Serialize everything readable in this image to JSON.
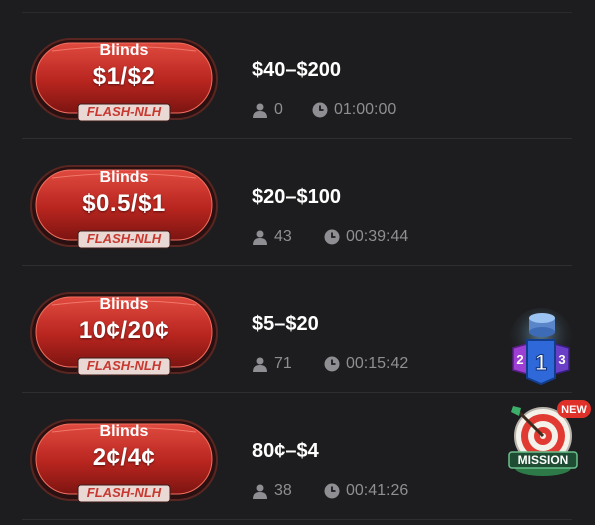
{
  "tables": [
    {
      "blinds_label": "Blinds",
      "blinds": "$1/$2",
      "game_type": "FLASH-NLH",
      "buy_in": "$40–$200",
      "players": "0",
      "time": "01:00:00"
    },
    {
      "blinds_label": "Blinds",
      "blinds": "$0.5/$1",
      "game_type": "FLASH-NLH",
      "buy_in": "$20–$100",
      "players": "43",
      "time": "00:39:44"
    },
    {
      "blinds_label": "Blinds",
      "blinds": "10¢/20¢",
      "game_type": "FLASH-NLH",
      "buy_in": "$5–$20",
      "players": "71",
      "time": "00:15:42"
    },
    {
      "blinds_label": "Blinds",
      "blinds": "2¢/4¢",
      "game_type": "FLASH-NLH",
      "buy_in": "80¢–$4",
      "players": "38",
      "time": "00:41:26"
    }
  ],
  "side_icons": {
    "ranking": {
      "icon": "ranking-podium-icon",
      "ranks": [
        "2",
        "1",
        "3"
      ]
    },
    "mission": {
      "icon": "mission-target-icon",
      "label": "MISSION",
      "new_badge": "NEW"
    }
  },
  "colors": {
    "background": "#1d1d1f",
    "badge_red": "#c8302a",
    "text_white": "#ffffff",
    "text_grey": "#8f8f93"
  }
}
